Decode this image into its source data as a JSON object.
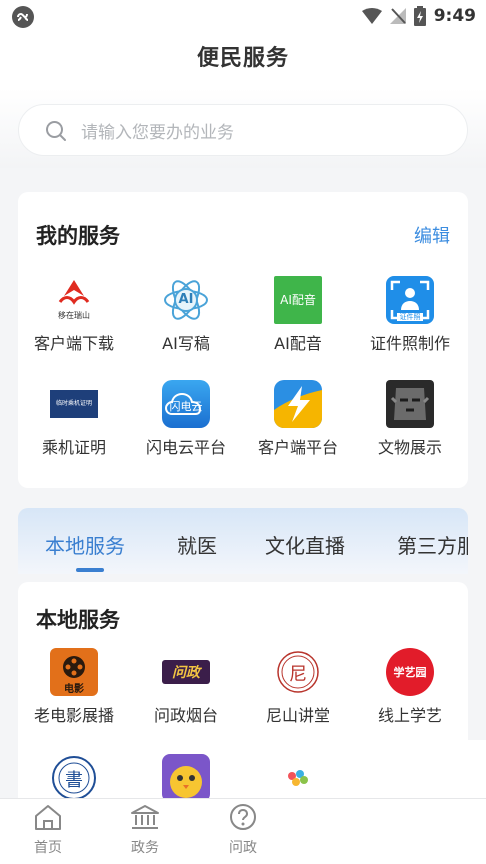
{
  "status_bar": {
    "time": "9:49"
  },
  "header": {
    "title": "便民服务"
  },
  "search": {
    "placeholder": "请输入您要办的业务"
  },
  "my_services": {
    "title": "我的服务",
    "edit_label": "编辑",
    "items": [
      {
        "label": "客户端下载",
        "icon": "app-download-icon",
        "icon_text": "移在瑞山"
      },
      {
        "label": "AI写稿",
        "icon": "ai-atom-icon",
        "icon_text": "AI"
      },
      {
        "label": "AI配音",
        "icon": "ai-voice-icon",
        "icon_text": "AI配音"
      },
      {
        "label": "证件照制作",
        "icon": "id-photo-icon",
        "icon_text": "证件照"
      },
      {
        "label": "乘机证明",
        "icon": "boarding-certificate-icon",
        "icon_text": "临时乘机证明"
      },
      {
        "label": "闪电云平台",
        "icon": "lightning-cloud-icon",
        "icon_text": "闪电云"
      },
      {
        "label": "客户端平台",
        "icon": "client-platform-icon"
      },
      {
        "label": "文物展示",
        "icon": "relic-mask-icon"
      }
    ]
  },
  "tabs": [
    {
      "label": "本地服务",
      "active": true
    },
    {
      "label": "就医",
      "active": false
    },
    {
      "label": "文化直播",
      "active": false
    },
    {
      "label": "第三方服",
      "active": false
    }
  ],
  "local_services": {
    "title": "本地服务",
    "items": [
      {
        "label": "老电影展播",
        "icon": "film-reel-icon",
        "icon_text": "电影"
      },
      {
        "label": "问政烟台",
        "icon": "wenzheng-icon",
        "icon_text": "问政"
      },
      {
        "label": "尼山讲堂",
        "icon": "nishan-seal-icon",
        "icon_text": "尼"
      },
      {
        "label": "线上学艺",
        "icon": "xueyi-icon",
        "icon_text": "学艺园"
      },
      {
        "label": "",
        "icon": "library-seal-icon",
        "icon_text": "書"
      },
      {
        "label": "",
        "icon": "chick-game-icon"
      },
      {
        "label": "",
        "icon": "colorful-logo-icon"
      }
    ]
  },
  "bottom_nav": [
    {
      "label": "首页",
      "icon": "home-icon"
    },
    {
      "label": "政务",
      "icon": "government-icon"
    },
    {
      "label": "问政",
      "icon": "question-icon"
    }
  ],
  "colors": {
    "accent": "#3a7fd0",
    "edit": "#3c8de0",
    "background": "#f4f5f7"
  }
}
